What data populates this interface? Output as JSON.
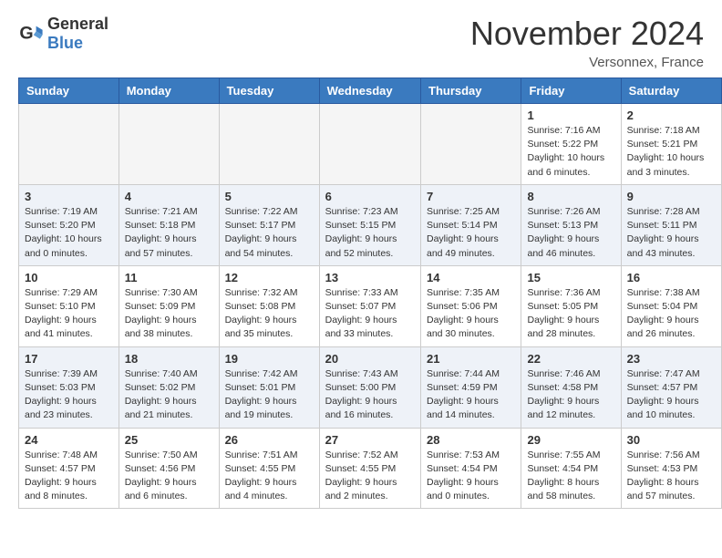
{
  "header": {
    "logo_line1": "General",
    "logo_line2": "Blue",
    "month": "November 2024",
    "location": "Versonnex, France"
  },
  "weekdays": [
    "Sunday",
    "Monday",
    "Tuesday",
    "Wednesday",
    "Thursday",
    "Friday",
    "Saturday"
  ],
  "weeks": [
    {
      "row_style": "white",
      "days": [
        {
          "num": "",
          "info": ""
        },
        {
          "num": "",
          "info": ""
        },
        {
          "num": "",
          "info": ""
        },
        {
          "num": "",
          "info": ""
        },
        {
          "num": "",
          "info": ""
        },
        {
          "num": "1",
          "info": "Sunrise: 7:16 AM\nSunset: 5:22 PM\nDaylight: 10 hours\nand 6 minutes."
        },
        {
          "num": "2",
          "info": "Sunrise: 7:18 AM\nSunset: 5:21 PM\nDaylight: 10 hours\nand 3 minutes."
        }
      ]
    },
    {
      "row_style": "alt",
      "days": [
        {
          "num": "3",
          "info": "Sunrise: 7:19 AM\nSunset: 5:20 PM\nDaylight: 10 hours\nand 0 minutes."
        },
        {
          "num": "4",
          "info": "Sunrise: 7:21 AM\nSunset: 5:18 PM\nDaylight: 9 hours\nand 57 minutes."
        },
        {
          "num": "5",
          "info": "Sunrise: 7:22 AM\nSunset: 5:17 PM\nDaylight: 9 hours\nand 54 minutes."
        },
        {
          "num": "6",
          "info": "Sunrise: 7:23 AM\nSunset: 5:15 PM\nDaylight: 9 hours\nand 52 minutes."
        },
        {
          "num": "7",
          "info": "Sunrise: 7:25 AM\nSunset: 5:14 PM\nDaylight: 9 hours\nand 49 minutes."
        },
        {
          "num": "8",
          "info": "Sunrise: 7:26 AM\nSunset: 5:13 PM\nDaylight: 9 hours\nand 46 minutes."
        },
        {
          "num": "9",
          "info": "Sunrise: 7:28 AM\nSunset: 5:11 PM\nDaylight: 9 hours\nand 43 minutes."
        }
      ]
    },
    {
      "row_style": "white",
      "days": [
        {
          "num": "10",
          "info": "Sunrise: 7:29 AM\nSunset: 5:10 PM\nDaylight: 9 hours\nand 41 minutes."
        },
        {
          "num": "11",
          "info": "Sunrise: 7:30 AM\nSunset: 5:09 PM\nDaylight: 9 hours\nand 38 minutes."
        },
        {
          "num": "12",
          "info": "Sunrise: 7:32 AM\nSunset: 5:08 PM\nDaylight: 9 hours\nand 35 minutes."
        },
        {
          "num": "13",
          "info": "Sunrise: 7:33 AM\nSunset: 5:07 PM\nDaylight: 9 hours\nand 33 minutes."
        },
        {
          "num": "14",
          "info": "Sunrise: 7:35 AM\nSunset: 5:06 PM\nDaylight: 9 hours\nand 30 minutes."
        },
        {
          "num": "15",
          "info": "Sunrise: 7:36 AM\nSunset: 5:05 PM\nDaylight: 9 hours\nand 28 minutes."
        },
        {
          "num": "16",
          "info": "Sunrise: 7:38 AM\nSunset: 5:04 PM\nDaylight: 9 hours\nand 26 minutes."
        }
      ]
    },
    {
      "row_style": "alt",
      "days": [
        {
          "num": "17",
          "info": "Sunrise: 7:39 AM\nSunset: 5:03 PM\nDaylight: 9 hours\nand 23 minutes."
        },
        {
          "num": "18",
          "info": "Sunrise: 7:40 AM\nSunset: 5:02 PM\nDaylight: 9 hours\nand 21 minutes."
        },
        {
          "num": "19",
          "info": "Sunrise: 7:42 AM\nSunset: 5:01 PM\nDaylight: 9 hours\nand 19 minutes."
        },
        {
          "num": "20",
          "info": "Sunrise: 7:43 AM\nSunset: 5:00 PM\nDaylight: 9 hours\nand 16 minutes."
        },
        {
          "num": "21",
          "info": "Sunrise: 7:44 AM\nSunset: 4:59 PM\nDaylight: 9 hours\nand 14 minutes."
        },
        {
          "num": "22",
          "info": "Sunrise: 7:46 AM\nSunset: 4:58 PM\nDaylight: 9 hours\nand 12 minutes."
        },
        {
          "num": "23",
          "info": "Sunrise: 7:47 AM\nSunset: 4:57 PM\nDaylight: 9 hours\nand 10 minutes."
        }
      ]
    },
    {
      "row_style": "white",
      "days": [
        {
          "num": "24",
          "info": "Sunrise: 7:48 AM\nSunset: 4:57 PM\nDaylight: 9 hours\nand 8 minutes."
        },
        {
          "num": "25",
          "info": "Sunrise: 7:50 AM\nSunset: 4:56 PM\nDaylight: 9 hours\nand 6 minutes."
        },
        {
          "num": "26",
          "info": "Sunrise: 7:51 AM\nSunset: 4:55 PM\nDaylight: 9 hours\nand 4 minutes."
        },
        {
          "num": "27",
          "info": "Sunrise: 7:52 AM\nSunset: 4:55 PM\nDaylight: 9 hours\nand 2 minutes."
        },
        {
          "num": "28",
          "info": "Sunrise: 7:53 AM\nSunset: 4:54 PM\nDaylight: 9 hours\nand 0 minutes."
        },
        {
          "num": "29",
          "info": "Sunrise: 7:55 AM\nSunset: 4:54 PM\nDaylight: 8 hours\nand 58 minutes."
        },
        {
          "num": "30",
          "info": "Sunrise: 7:56 AM\nSunset: 4:53 PM\nDaylight: 8 hours\nand 57 minutes."
        }
      ]
    }
  ]
}
